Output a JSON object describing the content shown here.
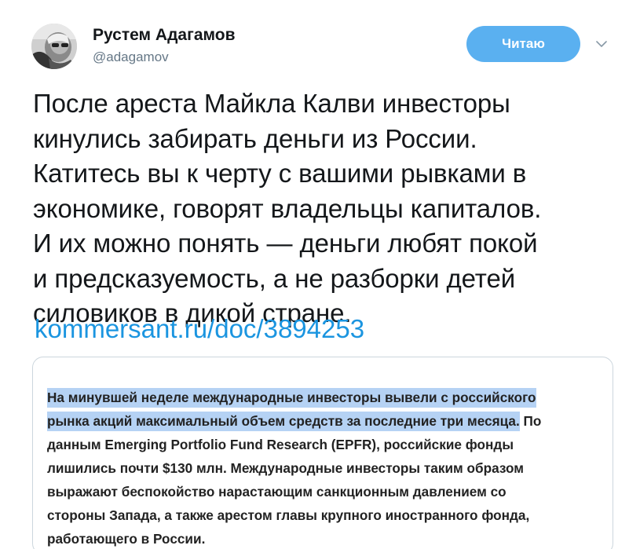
{
  "author": {
    "name": "Рустем Адагамов",
    "handle": "@adagamov",
    "avatar_icon": "avatar-photo"
  },
  "follow_button": {
    "label": "Читаю",
    "color": "#5ab0f0"
  },
  "menu_icon": "chevron-down-icon",
  "tweet": {
    "text": "После ареста Майкла Калви инвесторы\nкинулись забирать деньги из России.\nКатитесь вы к черту с вашими рывками в\nэкономике, говорят владельцы капиталов.\nИ их можно понять — деньги любят покой\nи предсказуемость, а не разборки детей\nсиловиков в дикой стране.",
    "link": "kommersant.ru/doc/3894253",
    "link_color": "#1b95e0"
  },
  "quote": {
    "highlight_color": "#b5d2f4",
    "lines": [
      {
        "highlighted": "На минувшей неделе международные инвесторы вывели с российского",
        "rest": ""
      },
      {
        "highlighted": "рынка акций максимальный объем средств за последние три месяца.",
        "rest": " По"
      },
      {
        "highlighted": "",
        "rest": "данным Emerging Portfolio Fund Research (EPFR), российские фонды"
      },
      {
        "highlighted": "",
        "rest": "лишились почти $130 млн. Международные инвесторы таким образом"
      },
      {
        "highlighted": "",
        "rest": "выражают беспокойство нарастающим санкционным давлением со"
      },
      {
        "highlighted": "",
        "rest": "стороны Запада, а также арестом главы крупного иностранного фонда,"
      },
      {
        "highlighted": "",
        "rest": "работающего в России."
      }
    ]
  }
}
